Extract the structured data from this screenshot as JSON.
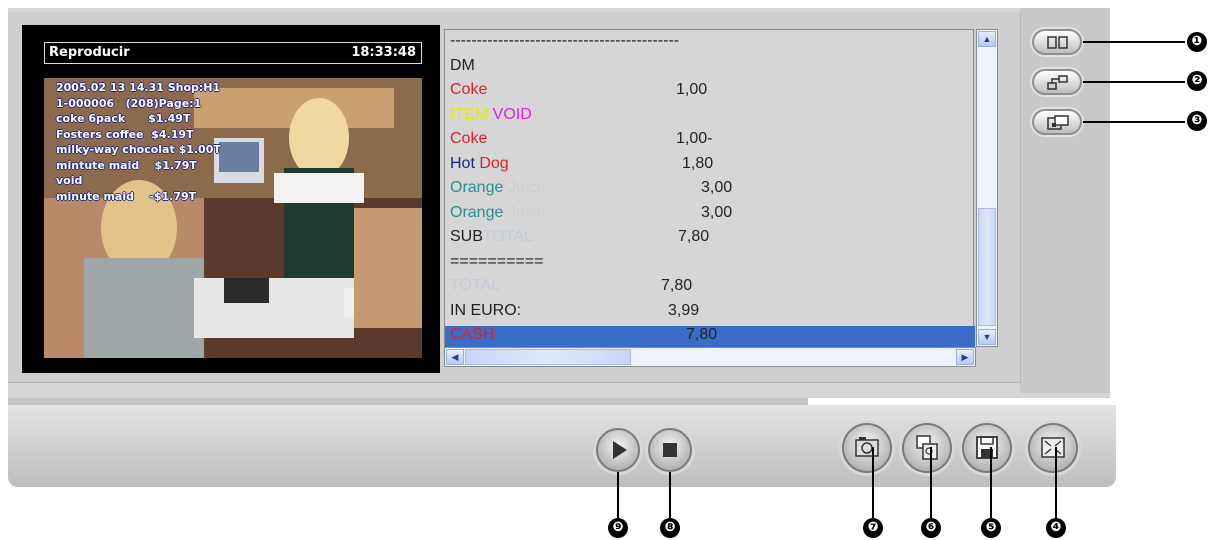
{
  "video": {
    "title": "Reproducir",
    "time": "18:33:48",
    "overlay_lines": [
      "2005.02 13 14.31 Shop:H1",
      "1-000006   (208)Page:1",
      "coke 6pack      $1.49T",
      "Fosters coffee  $4.19T",
      "milky-way chocolat $1.00T",
      "mintute maid    $1.79T",
      "void",
      "minute maid    -$1.79T"
    ]
  },
  "log": {
    "lines": [
      {
        "parts": [
          {
            "text": "-------------------------------------------",
            "color": "#222222"
          }
        ],
        "value": ""
      },
      {
        "parts": [
          {
            "text": "DM",
            "color": "#222222"
          }
        ],
        "value": ""
      },
      {
        "parts": [
          {
            "text": "Coke",
            "color": "#e02020"
          }
        ],
        "value": "1,00"
      },
      {
        "parts": [
          {
            "text": "ITEM",
            "color": "#e6e60e"
          },
          {
            "text": " VOID",
            "color": "#e020e0"
          }
        ],
        "value": ""
      },
      {
        "parts": [
          {
            "text": "Coke",
            "color": "#e02020"
          }
        ],
        "value": "1,00-"
      },
      {
        "parts": [
          {
            "text": "Hot",
            "color": "#20208a"
          },
          {
            "text": " Dog",
            "color": "#e02020"
          }
        ],
        "value": "1,80"
      },
      {
        "parts": [
          {
            "text": "Orange",
            "color": "#2a8f8f"
          },
          {
            "text": " Juice",
            "color": "#c8d2c8"
          }
        ],
        "value": "3,00"
      },
      {
        "parts": [
          {
            "text": "Orange",
            "color": "#2a8f8f"
          },
          {
            "text": " Juice",
            "color": "#c8d2c8"
          }
        ],
        "value": "3,00"
      },
      {
        "parts": [
          {
            "text": "SUB",
            "color": "#222222"
          },
          {
            "text": "TOTAL",
            "color": "#c0ccd8"
          }
        ],
        "value": "7,80"
      },
      {
        "parts": [
          {
            "text": "==========",
            "color": "#222222"
          }
        ],
        "value": ""
      },
      {
        "parts": [
          {
            "text": "TOTAL",
            "color": "#c0ccd8"
          }
        ],
        "value": "7,80"
      },
      {
        "parts": [
          {
            "text": "IN EURO:",
            "color": "#222222"
          }
        ],
        "value": "3,99"
      },
      {
        "parts": [
          {
            "text": "CASH",
            "color": "#e02020"
          }
        ],
        "value": "7,80"
      }
    ]
  },
  "scroll": {
    "up": "▲",
    "down": "▼",
    "left": "◀",
    "right": "▶"
  },
  "callouts": {
    "n1": "❶",
    "n2": "❷",
    "n3": "❸",
    "n4": "❹",
    "n5": "❺",
    "n6": "❻",
    "n7": "❼",
    "n8": "❽",
    "n9": "❾"
  },
  "icons": {
    "pill1": "split-view-icon",
    "pill2": "network-icon",
    "pill3": "window-icon",
    "play": "play-icon",
    "stop": "stop-icon",
    "snapshot": "camera-icon",
    "zoom": "zoom-icon",
    "save": "floppy-disk-icon",
    "fullscreen": "fullscreen-icon"
  },
  "colors": {
    "selection": "#3a6dc7",
    "panel_bg": "#d6d6d6",
    "frame_bg": "#d5d5d5"
  }
}
